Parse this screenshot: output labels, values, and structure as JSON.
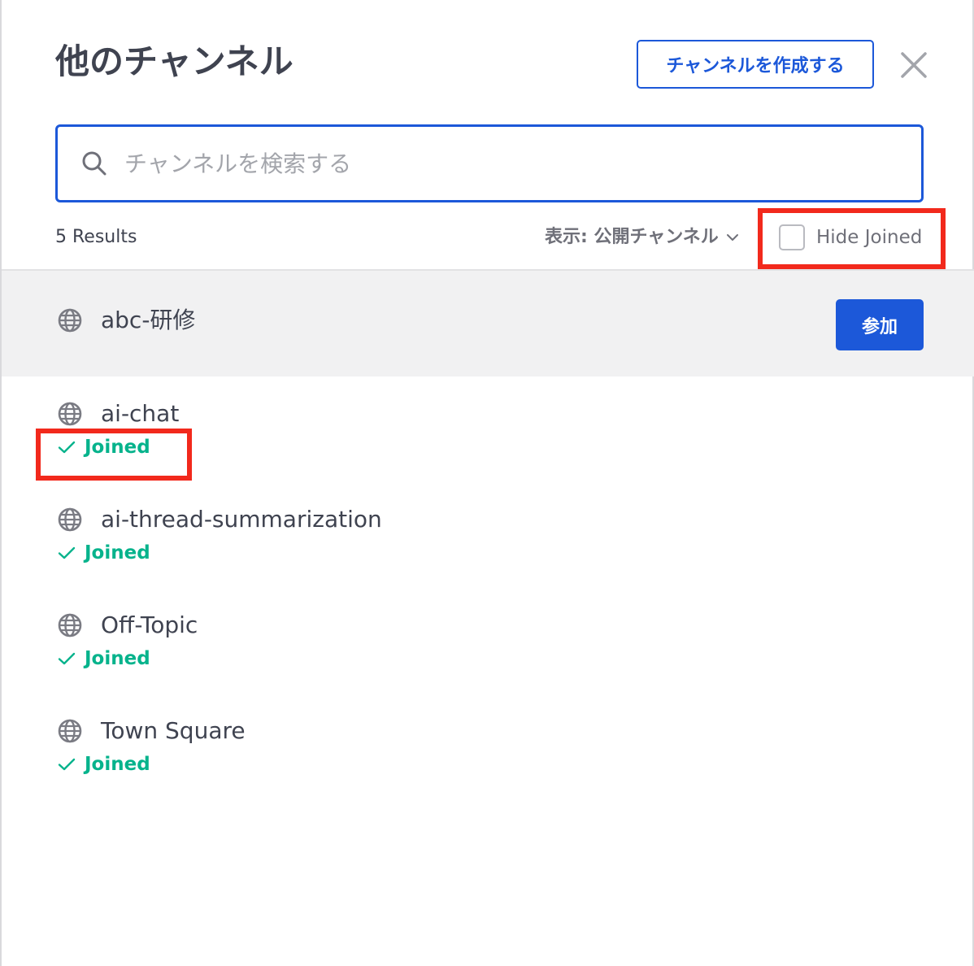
{
  "modal": {
    "title": "他のチャンネル",
    "create_button_label": "チャンネルを作成する",
    "close_icon": "close-icon"
  },
  "search": {
    "placeholder": "チャンネルを検索する",
    "value": "",
    "icon": "search-icon"
  },
  "toolbar": {
    "results_count": "5 Results",
    "filter_label": "表示: 公開チャンネル",
    "hide_joined_label": "Hide Joined",
    "hide_joined_checked": false
  },
  "channels": [
    {
      "name": "abc-研修",
      "joined": false,
      "action_label": "参加",
      "icon": "globe-icon"
    },
    {
      "name": "ai-chat",
      "joined": true,
      "status_label": "Joined",
      "icon": "globe-icon"
    },
    {
      "name": "ai-thread-summarization",
      "joined": true,
      "status_label": "Joined",
      "icon": "globe-icon"
    },
    {
      "name": "Off-Topic",
      "joined": true,
      "status_label": "Joined",
      "icon": "globe-icon"
    },
    {
      "name": "Town Square",
      "joined": true,
      "status_label": "Joined",
      "icon": "globe-icon"
    }
  ],
  "colors": {
    "accent": "#1c58d9",
    "joined": "#06b38c",
    "annotation": "#f2291c"
  }
}
